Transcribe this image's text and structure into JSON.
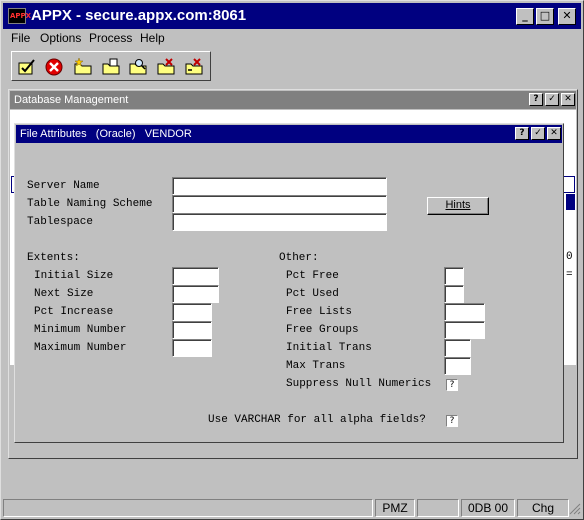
{
  "window": {
    "title": "APPX - secure.appx.com:8061",
    "logo_text": "APPX",
    "controls": {
      "minimize": "_",
      "maximize": "□",
      "close": "✕"
    }
  },
  "menu": [
    "File",
    "Options",
    "Process",
    "Help"
  ],
  "toolbar": {
    "items": [
      "confirm-icon",
      "cancel-icon",
      "new-folder-icon",
      "open-folder-icon",
      "find-folder-icon",
      "delete-folder-icon",
      "redo-folder-icon"
    ]
  },
  "db_window": {
    "title": "Database Management",
    "controls": {
      "help": "?",
      "ok": "✓",
      "close": "✕"
    },
    "peek_right": [
      "0",
      "="
    ]
  },
  "dialog": {
    "title": "File Attributes   (Oracle)   VENDOR",
    "controls": {
      "help": "?",
      "ok": "✓",
      "close": "✕"
    },
    "fields": {
      "server_name": {
        "label": "Server Name",
        "value": ""
      },
      "table_naming_scheme": {
        "label": "Table Naming Scheme",
        "value": ""
      },
      "tablespace": {
        "label": "Tablespace",
        "value": ""
      }
    },
    "hints_button": "Hints",
    "extents": {
      "heading": "Extents:",
      "initial_size": {
        "label": "Initial Size",
        "value": ""
      },
      "next_size": {
        "label": "Next Size",
        "value": ""
      },
      "pct_increase": {
        "label": "Pct Increase",
        "value": ""
      },
      "minimum_number": {
        "label": "Minimum Number",
        "value": ""
      },
      "maximum_number": {
        "label": "Maximum Number",
        "value": ""
      }
    },
    "other": {
      "heading": "Other:",
      "pct_free": {
        "label": "Pct Free",
        "value": ""
      },
      "pct_used": {
        "label": "Pct Used",
        "value": ""
      },
      "free_lists": {
        "label": "Free Lists",
        "value": ""
      },
      "free_groups": {
        "label": "Free Groups",
        "value": ""
      },
      "initial_trans": {
        "label": "Initial Trans",
        "value": ""
      },
      "max_trans": {
        "label": "Max Trans",
        "value": ""
      },
      "suppress_null_numerics": {
        "label": "Suppress Null Numerics",
        "value": "?"
      }
    },
    "varchar": {
      "label": "Use VARCHAR for all alpha fields?",
      "value": "?"
    }
  },
  "status_bar": {
    "mode": "PMZ",
    "blank": "",
    "db": "0DB 00",
    "state": "Chg"
  },
  "colors": {
    "title_active": "#000080",
    "title_inactive": "#808080",
    "face": "#c0c0c0"
  }
}
